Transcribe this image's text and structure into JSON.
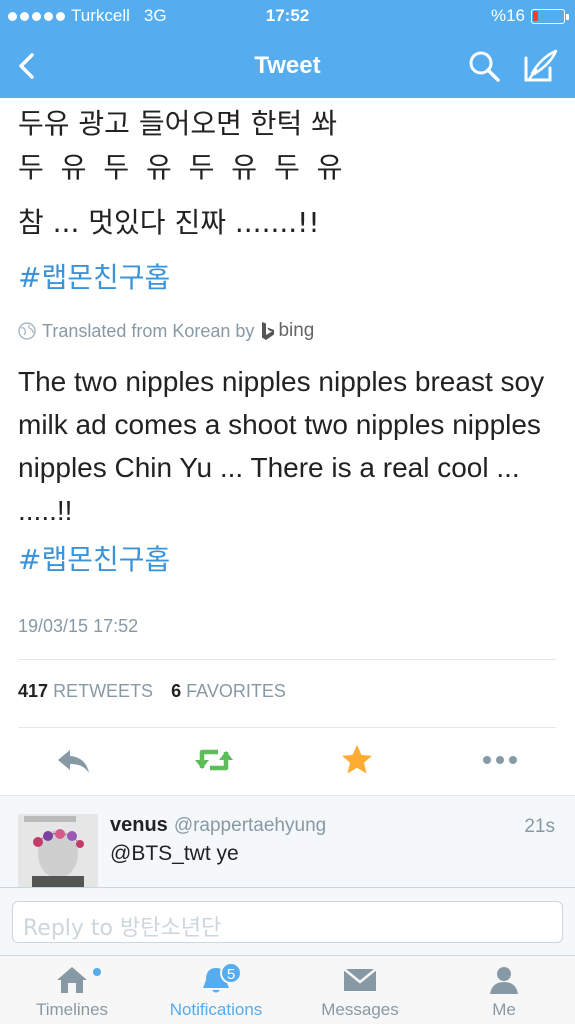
{
  "status": {
    "carrier": "Turkcell",
    "network": "3G",
    "time": "17:52",
    "battery": "%16",
    "battery_level": 0.16
  },
  "nav": {
    "title": "Tweet",
    "back_icon": "chevron-left-icon",
    "search_icon": "search-icon",
    "compose_icon": "compose-icon"
  },
  "tweet": {
    "korean_line1": "두유 광고 들어오면 한턱 쏴",
    "korean_line2": "두 유 두 유 두 유 두 유",
    "korean_line3": "참 ... 멋있다 진짜 .......!!",
    "hashtag": "#랩몬친구홉",
    "translated_label": "Translated from Korean by",
    "translator": "bing",
    "translation": "The two nipples nipples nipples breast soy milk ad comes a shoot two nipples nipples nipples Chin Yu ... There is a real cool ... .....!!",
    "hashtag2": "#랩몬친구홉",
    "date": "19/03/15 17:52",
    "retweets_count": "417",
    "retweets_label": "RETWEETS",
    "favorites_count": "6",
    "favorites_label": "FAVORITES"
  },
  "actions": {
    "reply_icon": "reply-icon",
    "retweet_icon": "retweet-icon",
    "favorite_icon": "star-icon",
    "more_icon": "more-icon",
    "accent_green": "#5cbd59",
    "accent_star": "#ffac33"
  },
  "reply": {
    "name": "venus",
    "handle": "@rappertaehyung",
    "time": "21s",
    "text": "@BTS_twt ye"
  },
  "replybox": {
    "placeholder": "Reply to 방탄소년단"
  },
  "tabs": [
    {
      "label": "Timelines",
      "icon": "home-icon"
    },
    {
      "label": "Notifications",
      "icon": "bell-icon",
      "badge": "5"
    },
    {
      "label": "Messages",
      "icon": "envelope-icon"
    },
    {
      "label": "Me",
      "icon": "person-icon"
    }
  ],
  "colors": {
    "brand": "#55acee",
    "link": "#3b94d9",
    "muted": "#8899a6"
  }
}
